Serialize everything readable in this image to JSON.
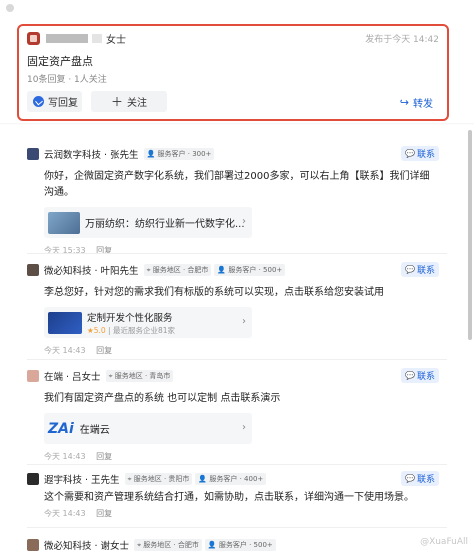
{
  "question": {
    "author_suffix": "女士",
    "time": "发布于今天 14:42",
    "title": "固定资产盘点",
    "stats": "10条回复 · 1人关注",
    "answer_label": "写回复",
    "follow_label": "关注",
    "forward_label": "转发"
  },
  "contact_label": "联系",
  "reply_label": "回复",
  "answers": [
    {
      "name": "云润数字科技 · 张先生",
      "tags": [
        "服务客户 · 300+"
      ],
      "text": "你好，企微固定资产数字化系统，我们部署过2000多家，可以右上角【联系】我们详细沟通。",
      "attach_title": "万丽纺织：纺织行业新一代数字化...",
      "time": "今天 15:33"
    },
    {
      "name": "微必知科技 · 叶阳先生",
      "tags": [
        "服务地区 · 合肥市",
        "服务客户 · 500+"
      ],
      "text": "李总您好，针对您的需求我们有标版的系统可以实现，点击联系给您安装试用",
      "attach_title": "定制开发个性化服务",
      "attach_rating": "5.0",
      "attach_sub": "最近服务企业81家",
      "time": "今天 14:43"
    },
    {
      "name": "在端 · 吕女士",
      "tags": [
        "服务地区 · 青岛市"
      ],
      "text": "我们有固定资产盘点的系统 也可以定制 点击联系演示",
      "attach_logo": "ZAi",
      "attach_title": "在端云",
      "time": "今天 14:43"
    },
    {
      "name": "遐宇科技 · 王先生",
      "tags": [
        "服务地区 · 贵阳市",
        "服务客户 · 400+"
      ],
      "text": "这个需要和资产管理系统结合打通，如需协助，点击联系，详细沟通一下使用场景。",
      "time": "今天 14:43"
    },
    {
      "name": "微必知科技 · 谢女士",
      "tags": [
        "服务地区 · 合肥市",
        "服务客户 · 500+"
      ]
    }
  ],
  "watermark": "@XuaFuAll",
  "colors": {
    "accent": "#1a5fd6",
    "highlight_border": "#e14d3a"
  }
}
